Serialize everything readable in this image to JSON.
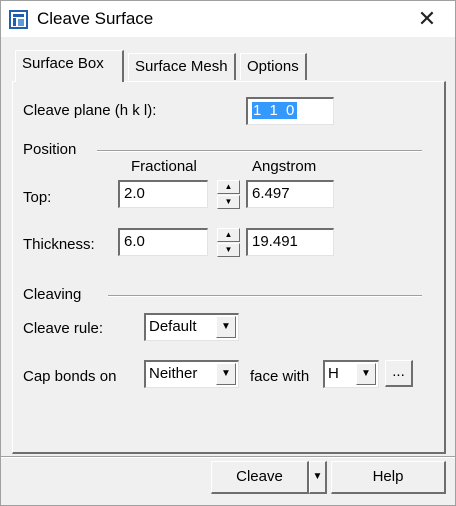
{
  "window": {
    "title": "Cleave Surface",
    "close_glyph": "✕",
    "app_icon": "materials-studio-window-icon"
  },
  "tabs": [
    {
      "label": "Surface Box",
      "active": true
    },
    {
      "label": "Surface Mesh",
      "active": false
    },
    {
      "label": "Options",
      "active": false
    }
  ],
  "cleave_plane": {
    "label": "Cleave plane (h k l):",
    "value": "1 1 0"
  },
  "position": {
    "group_label": "Position",
    "col_fractional": "Fractional",
    "col_angstrom": "Angstrom",
    "top": {
      "label": "Top:",
      "fractional": "2.0",
      "angstrom": "6.497"
    },
    "thickness": {
      "label": "Thickness:",
      "fractional": "6.0",
      "angstrom": "19.491"
    }
  },
  "cleaving": {
    "group_label": "Cleaving",
    "rule_label": "Cleave rule:",
    "rule_value": "Default",
    "cap_label": "Cap bonds on",
    "cap_value": "Neither",
    "face_label": "face with",
    "face_value": "H",
    "more_button": "..."
  },
  "buttons": {
    "cleave": "Cleave",
    "help": "Help"
  },
  "icons": {
    "spin_up": "▲",
    "spin_down": "▼",
    "dropdown": "▼"
  }
}
